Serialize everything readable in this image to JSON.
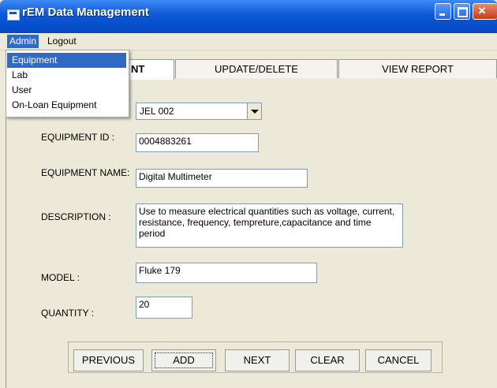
{
  "window": {
    "title": "rEM Data Management",
    "menu": {
      "admin": "Admin",
      "logout": "Logout"
    },
    "admin_dropdown": [
      "Equipment",
      "Lab",
      "User",
      "On-Loan Equipment"
    ]
  },
  "tabs": {
    "tab1_visible": "NT",
    "tab2": "UPDATE/DELETE",
    "tab3": "VIEW REPORT"
  },
  "form": {
    "selector_value": "JEL 002",
    "equipment_id_label": "EQUIPMENT ID :",
    "equipment_id_value": "0004883261",
    "equipment_name_label": "EQUIPMENT NAME:",
    "equipment_name_value": "Digital Multimeter",
    "description_label": "DESCRIPTION :",
    "description_value": "Use to measure electrical quantities such as voltage, current, resistance, frequency, tempreture,capacitance and time period",
    "model_label": "MODEL :",
    "model_value": "Fluke 179",
    "quantity_label": "QUANTITY :",
    "quantity_value": "20"
  },
  "buttons": {
    "previous": "PREVIOUS",
    "add": "ADD",
    "next": "NEXT",
    "clear": "CLEAR",
    "cancel": "CANCEL"
  }
}
